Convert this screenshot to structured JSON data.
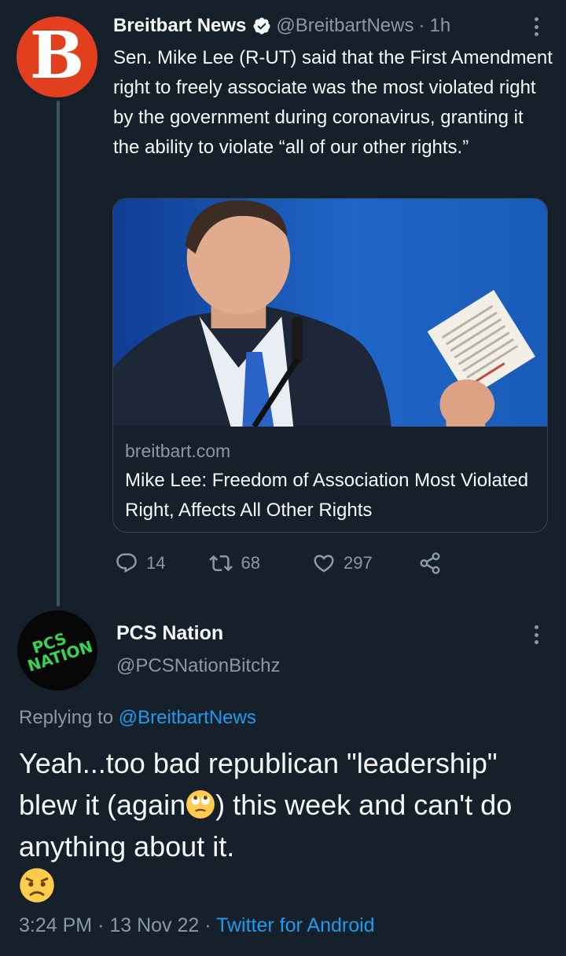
{
  "tweet": {
    "author_name": "Breitbart News",
    "author_handle": "@BreitbartNews",
    "time_ago": "1h",
    "separator": "·",
    "avatar_letter": "B",
    "text": "Sen. Mike Lee (R-UT) said that the First Amendment right to freely associate was the most violated right by the government during coronavirus, granting it the ability to violate “all of our other rights.”",
    "card": {
      "domain": "breitbart.com",
      "title": "Mike Lee: Freedom of Association Most Violated Right, Affects All Other Rights"
    },
    "actions": {
      "replies": "14",
      "retweets": "68",
      "likes": "297"
    }
  },
  "reply": {
    "author_name": "PCS Nation",
    "author_handle": "@PCSNationBitchz",
    "avatar_text_line1": "PCS",
    "avatar_text_line2": "NATION",
    "replying_prefix": "Replying to",
    "replying_to": "@BreitbartNews",
    "text_part1": "Yeah...too bad republican \"leadership\" blew it (again",
    "text_part2": ") this week and can't do anything about it.",
    "emoji_1": "eye-roll-emoji",
    "emoji_2": "angry-face-emoji",
    "time": "3:24 PM",
    "date": "13 Nov 22",
    "source": "Twitter for Android"
  },
  "colors": {
    "background": "#15202b",
    "text": "#f7f9f9",
    "muted": "#8b98a5",
    "link": "#1d9bf0",
    "brand_red": "#e23f1f",
    "avatar_green": "#39d353"
  }
}
